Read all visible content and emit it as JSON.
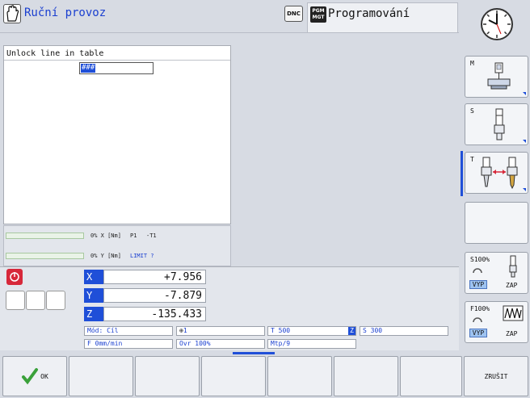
{
  "header": {
    "mode_title": "Ruční provoz",
    "dnc_label": "DNC",
    "pgm_label_top": "PGM",
    "pgm_label_bottom": "MGT",
    "program_tab": "Programování"
  },
  "dialog": {
    "title": "Unlock line in table",
    "input_value": "###"
  },
  "load": {
    "x_text": "0% X [Nm]",
    "x_extra1": "P1",
    "x_extra2": "-T1",
    "y_text": "0% Y [Nm]",
    "y_extra": "LIMIT ?"
  },
  "axes": [
    {
      "label": "X",
      "value": "+7.956"
    },
    {
      "label": "Y",
      "value": "-7.879"
    },
    {
      "label": "Z",
      "value": "-135.433"
    }
  ],
  "status": {
    "mode": "Mód: Cíl",
    "tool_count": "1",
    "tool": "T 500",
    "tool_axis": "Z",
    "spindle": "S 300",
    "feed": "F 0mm/min",
    "override": "Ovr 100%",
    "mtp": "Mtp/9"
  },
  "side_softkeys": {
    "m_label": "M",
    "s_label": "S",
    "t_label": "T",
    "s_override": "S100%",
    "f_override": "F100%",
    "vyp": "VYP",
    "zap": "ZAP"
  },
  "softkeys": {
    "ok": "OK",
    "cancel": "ZRUŠIT"
  },
  "colors": {
    "accent_blue": "#1f4fd8",
    "estop_red": "#d7283a",
    "ok_green": "#3aa13a"
  }
}
